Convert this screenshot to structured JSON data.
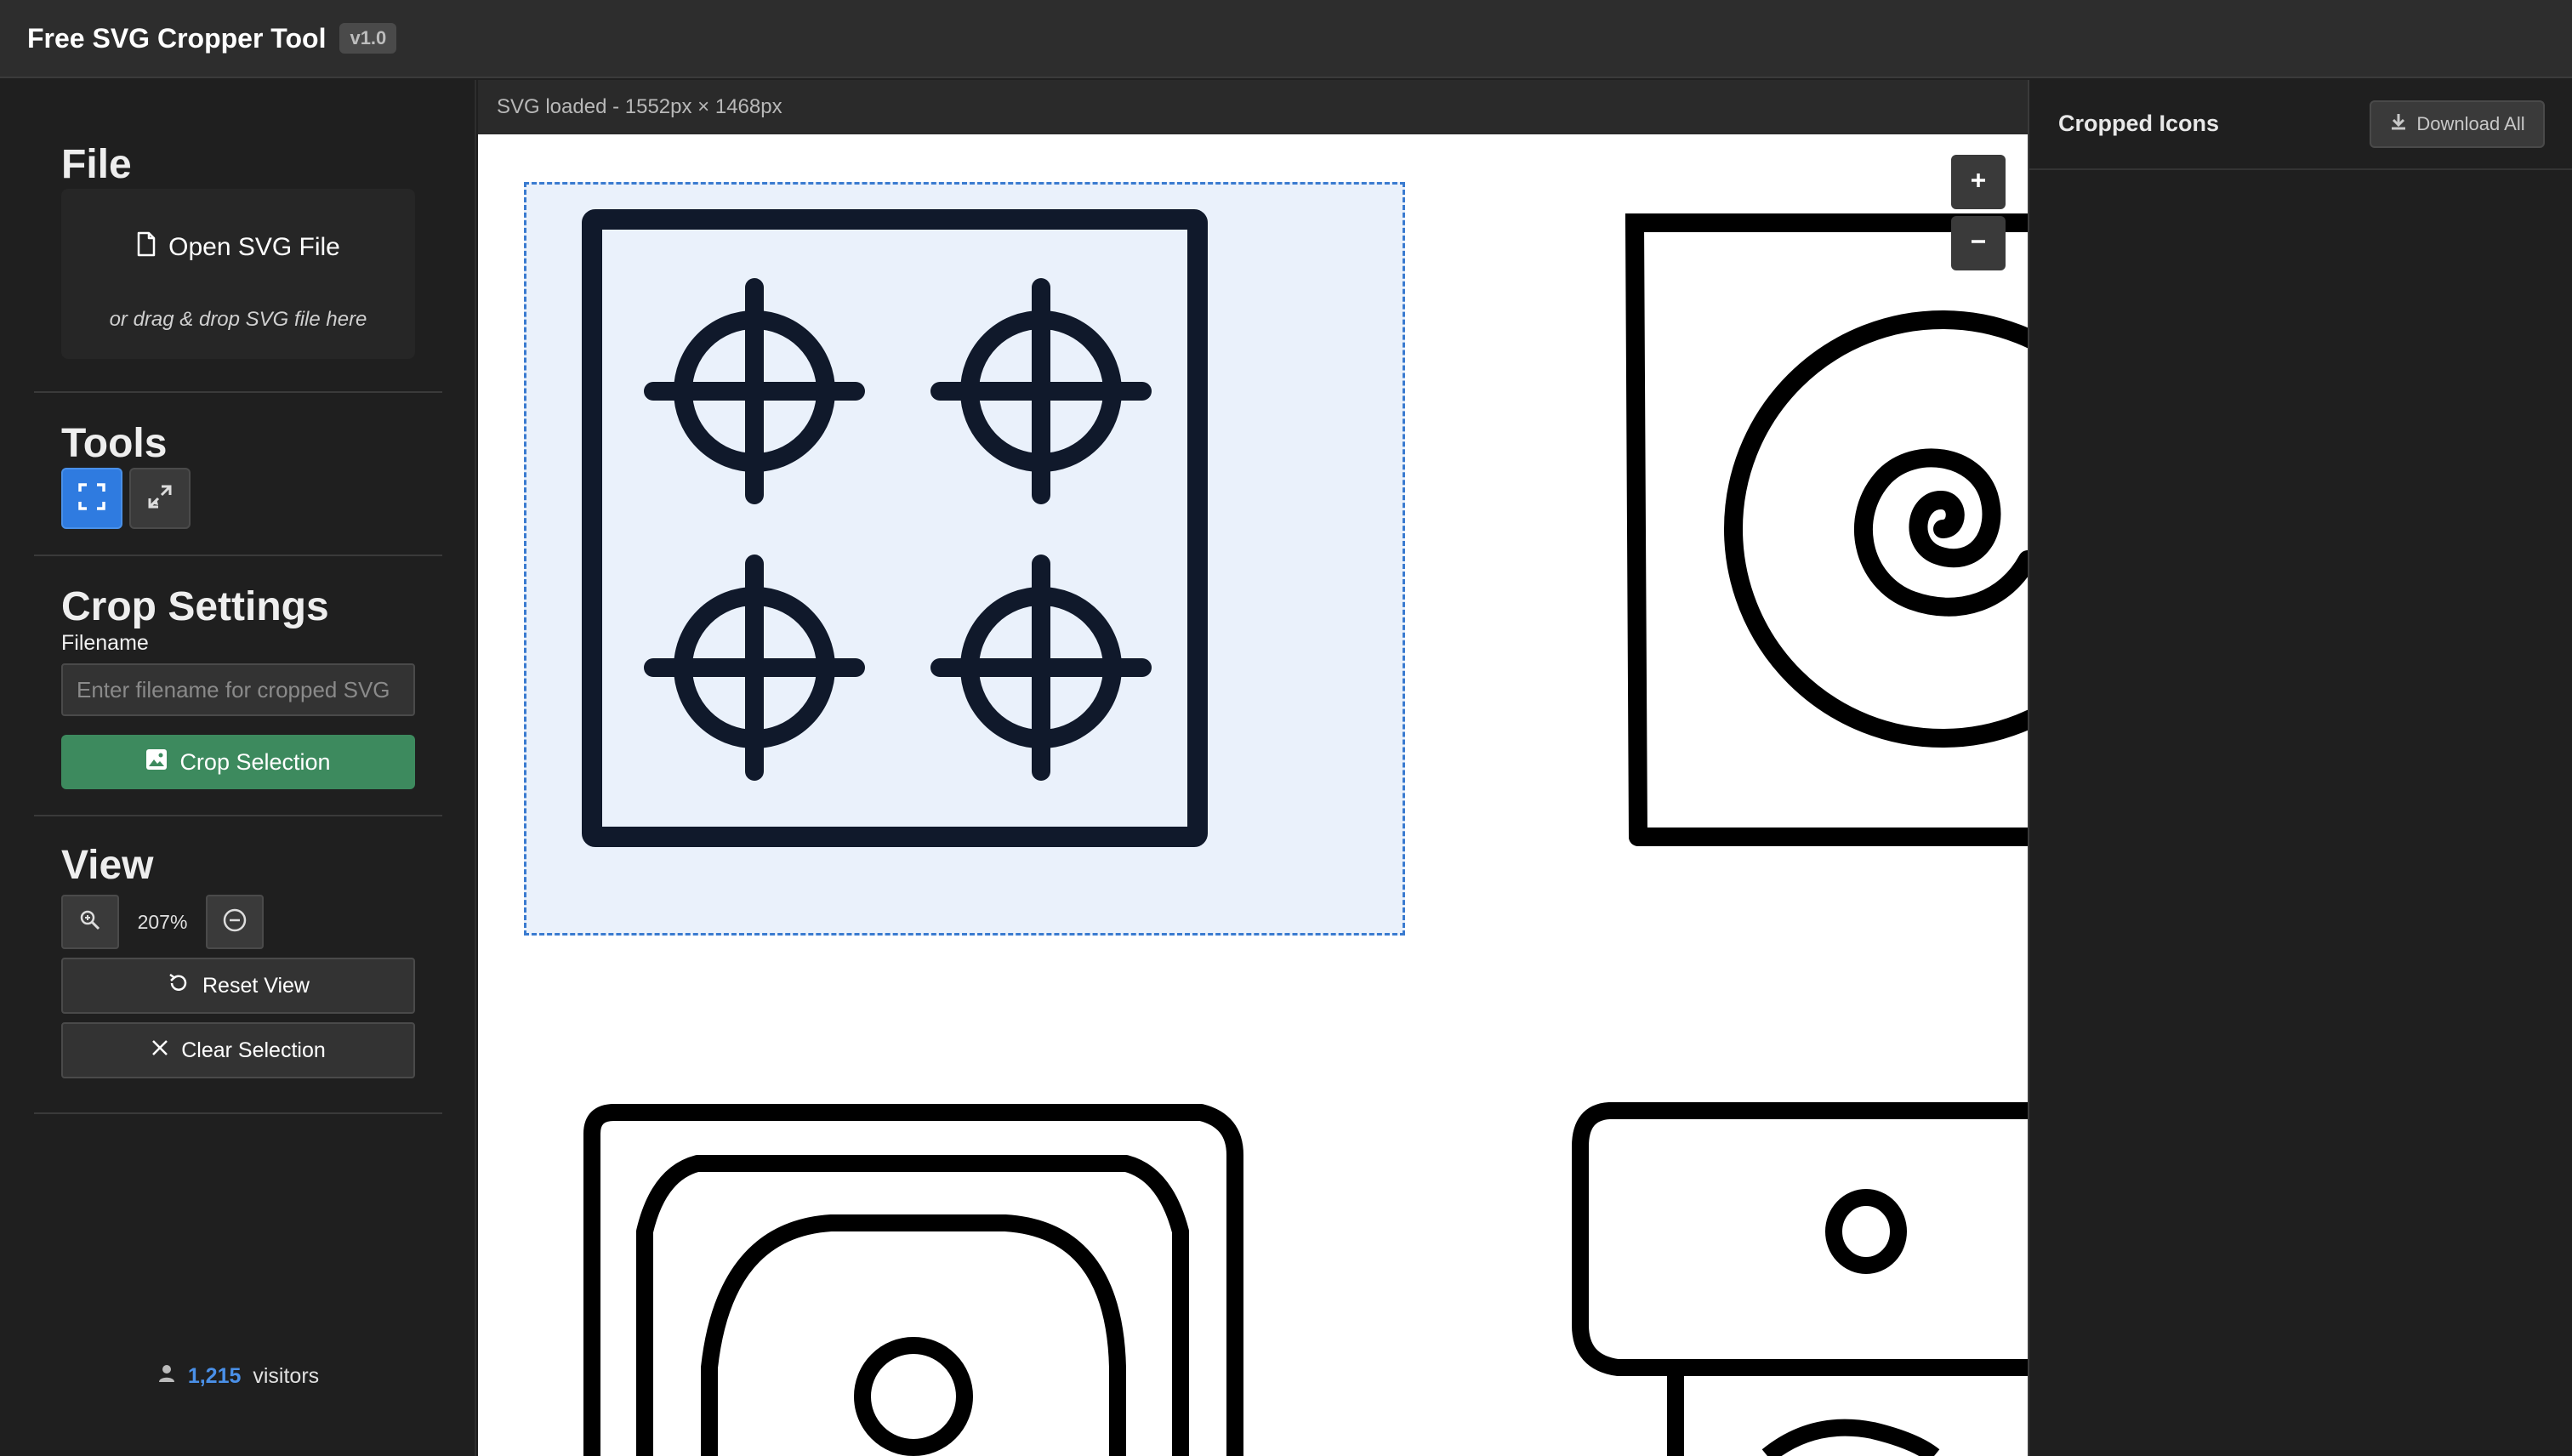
{
  "header": {
    "title": "Free SVG Cropper Tool",
    "version": "v1.0"
  },
  "sidebar": {
    "file": {
      "heading": "File",
      "open_button": "Open SVG File",
      "drop_hint": "or drag & drop SVG file here"
    },
    "tools": {
      "heading": "Tools",
      "items": [
        {
          "name": "select-crop-tool",
          "icon": "fullscreen-corners-icon",
          "active": true
        },
        {
          "name": "move-resize-tool",
          "icon": "arrows-move-icon",
          "active": false
        }
      ]
    },
    "crop_settings": {
      "heading": "Crop Settings",
      "filename_label": "Filename",
      "filename_placeholder": "Enter filename for cropped SVG",
      "filename_value": "",
      "crop_button": "Crop Selection"
    },
    "view": {
      "heading": "View",
      "zoom_level": "207%",
      "reset_button": "Reset View",
      "clear_button": "Clear Selection"
    },
    "visitors": {
      "count": "1,215",
      "label": "visitors"
    }
  },
  "canvas": {
    "status": "SVG loaded - 1552px × 1468px",
    "zoom_in_label": "+",
    "zoom_out_label": "−"
  },
  "right_panel": {
    "title": "Cropped Icons",
    "download_all": "Download All"
  },
  "colors": {
    "accent_blue": "#2f7be0",
    "crop_green": "#3d8a5e",
    "selection_border": "#3a7bd0"
  }
}
